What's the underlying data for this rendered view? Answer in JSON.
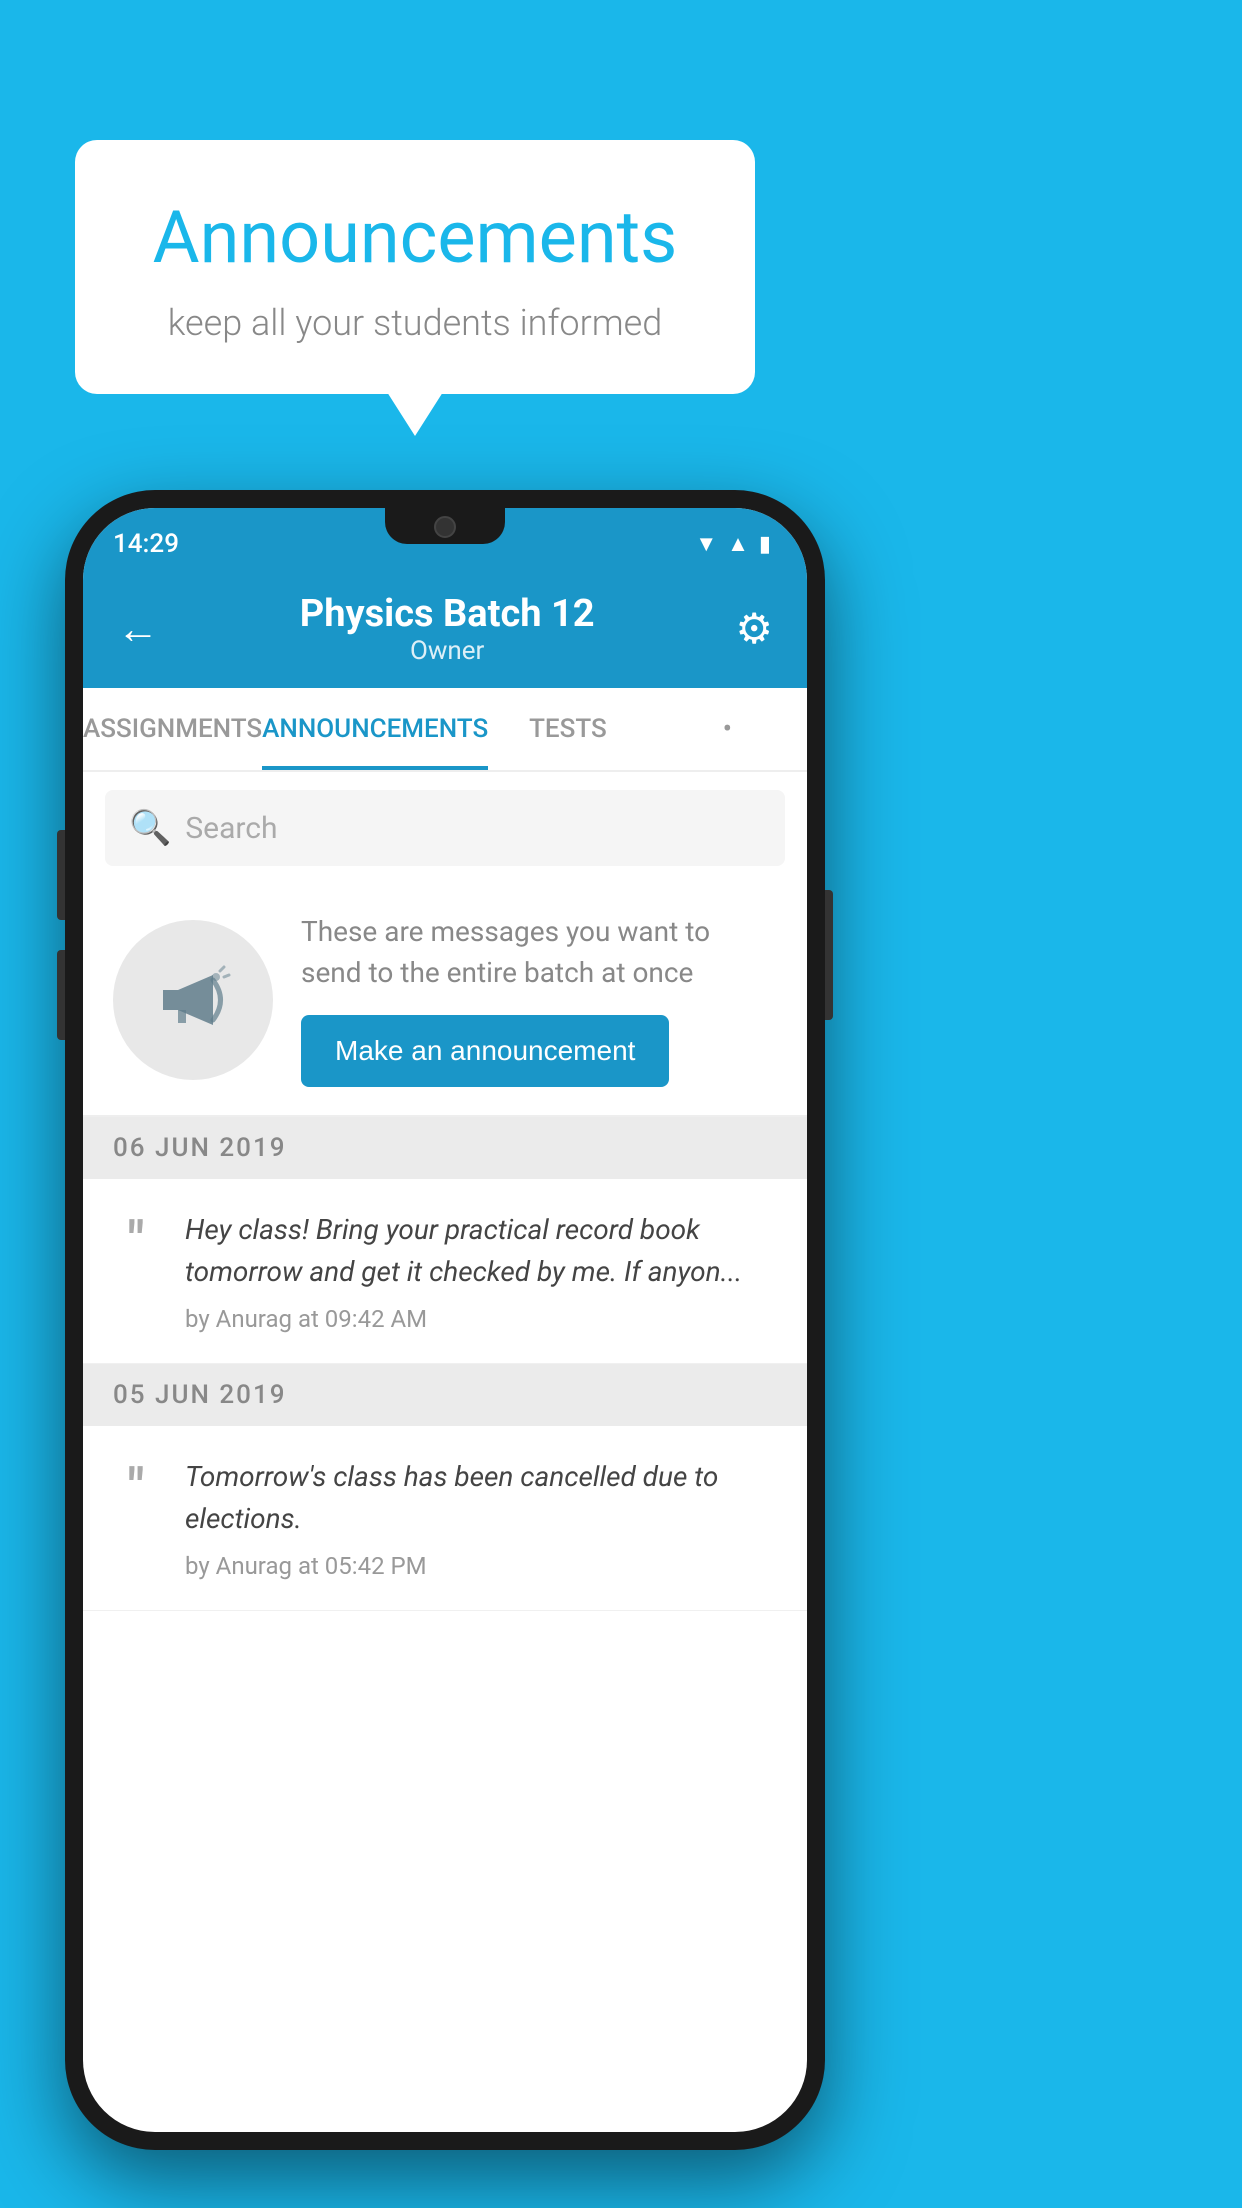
{
  "background": {
    "color": "#1ab7ea"
  },
  "speech_bubble": {
    "title": "Announcements",
    "subtitle": "keep all your students informed"
  },
  "phone": {
    "status_bar": {
      "time": "14:29",
      "icons": [
        "wifi",
        "signal",
        "battery"
      ]
    },
    "app_bar": {
      "title": "Physics Batch 12",
      "subtitle": "Owner",
      "back_label": "←",
      "settings_label": "⚙"
    },
    "tabs": [
      {
        "label": "ASSIGNMENTS",
        "active": false
      },
      {
        "label": "ANNOUNCEMENTS",
        "active": true
      },
      {
        "label": "TESTS",
        "active": false
      },
      {
        "label": "•",
        "active": false
      }
    ],
    "search": {
      "placeholder": "Search"
    },
    "promo": {
      "description": "These are messages you want to send to the entire batch at once",
      "button_label": "Make an announcement"
    },
    "announcements": [
      {
        "date": "06  JUN  2019",
        "items": [
          {
            "text": "Hey class! Bring your practical record book tomorrow and get it checked by me. If anyon...",
            "meta": "by Anurag at 09:42 AM"
          }
        ]
      },
      {
        "date": "05  JUN  2019",
        "items": [
          {
            "text": "Tomorrow's class has been cancelled due to elections.",
            "meta": "by Anurag at 05:42 PM"
          }
        ]
      }
    ]
  }
}
